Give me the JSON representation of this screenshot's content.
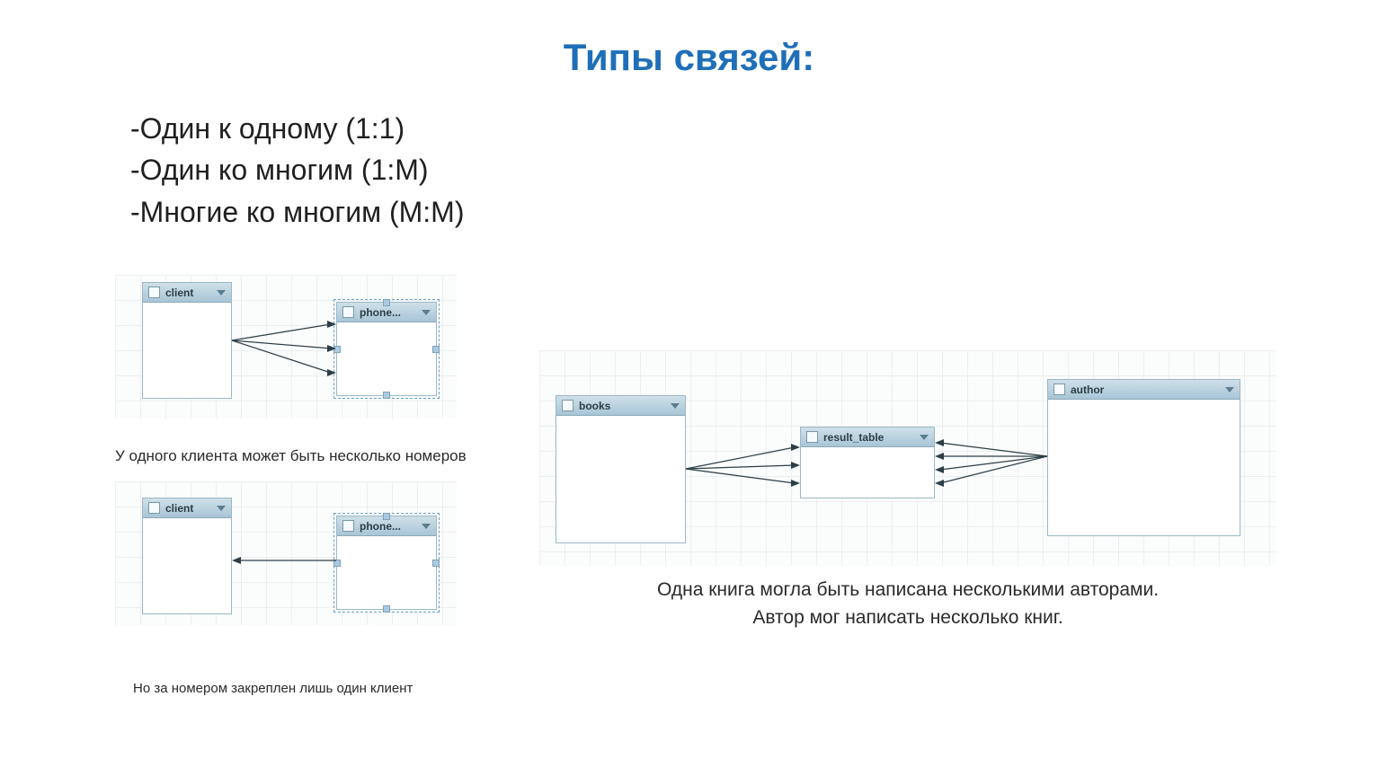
{
  "title": "Типы связей:",
  "bullets": {
    "b1": "-Один к одному (1:1)",
    "b2": "-Один ко многим (1:М)",
    "b3": "-Многие ко многим (М:М)"
  },
  "diagram_top": {
    "left_box": "client",
    "right_box": "phone...",
    "caption": "У одного клиента может быть несколько номеров"
  },
  "diagram_bottom": {
    "left_box": "client",
    "right_box": "phone...",
    "caption": "Но за номером закреплен лишь один клиент"
  },
  "diagram_right": {
    "box1": "books",
    "box2": "result_table",
    "box3": "author",
    "caption1": "Одна книга могла быть написана несколькими авторами.",
    "caption2": "Автор мог написать несколько книг."
  }
}
